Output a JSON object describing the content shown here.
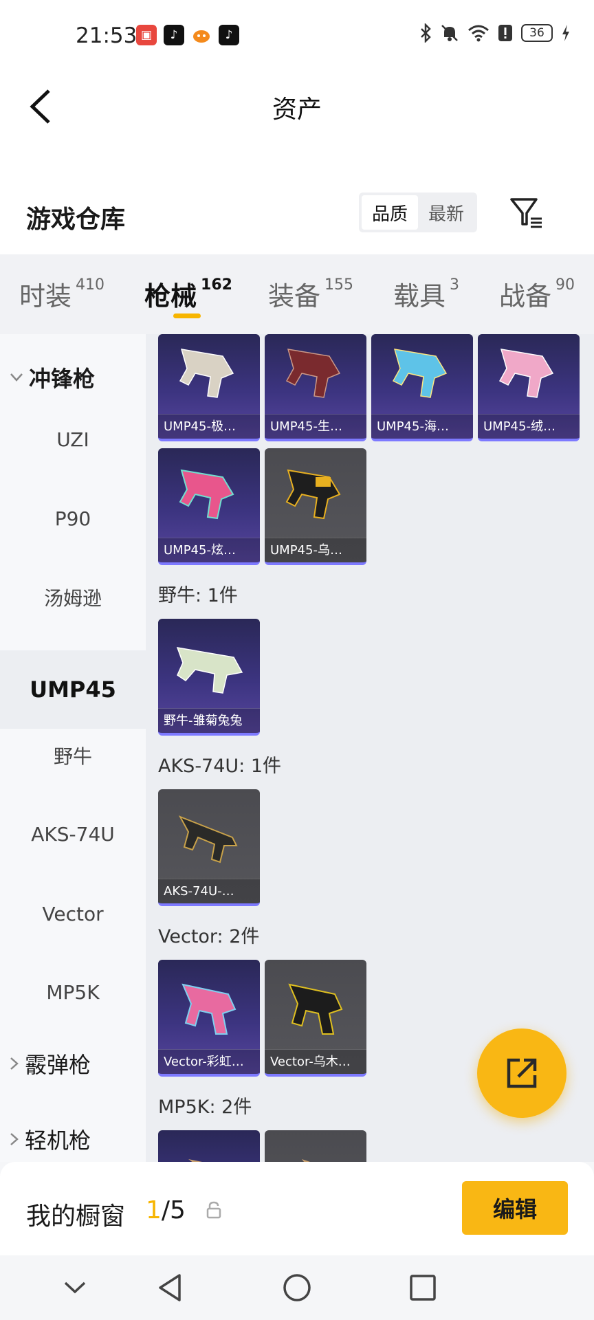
{
  "status_bar": {
    "time": "21:53",
    "apps": [
      "huawei-store",
      "tiktok",
      "taobao",
      "tiktok"
    ],
    "battery": "36"
  },
  "header": {
    "title": "资产"
  },
  "inventory": {
    "title": "游戏仓库",
    "sort_options": [
      "品质",
      "最新"
    ],
    "active_sort": "品质"
  },
  "tabs": [
    {
      "label": "时装",
      "count": "410"
    },
    {
      "label": "枪械",
      "count": "162"
    },
    {
      "label": "装备",
      "count": "155"
    },
    {
      "label": "载具",
      "count": "3"
    },
    {
      "label": "战备",
      "count": "90"
    }
  ],
  "active_tab": "枪械",
  "sidebar": {
    "groups": [
      {
        "label": "冲锋枪",
        "expanded": true
      },
      {
        "label": "霰弹枪",
        "expanded": false
      },
      {
        "label": "轻机枪",
        "expanded": false
      }
    ],
    "items": [
      "UZI",
      "P90",
      "汤姆逊",
      "UMP45",
      "野牛",
      "AKS-74U",
      "Vector",
      "MP5K"
    ],
    "active_item": "UMP45"
  },
  "content": {
    "ump_cards": [
      {
        "label": "UMP45-极…",
        "style": "purple",
        "color": "#d9d2c4"
      },
      {
        "label": "UMP45-生…",
        "style": "purple",
        "color": "#7a2a2e"
      },
      {
        "label": "UMP45-海…",
        "style": "purple",
        "color": "#5ec3e8"
      },
      {
        "label": "UMP45-绒…",
        "style": "purple",
        "color": "#f0a8c8"
      },
      {
        "label": "UMP45-炫…",
        "style": "purple",
        "color": "#e8568c"
      },
      {
        "label": "UMP45-乌…",
        "style": "gray",
        "color": "#e8b020"
      }
    ],
    "groups": [
      {
        "heading": "野牛: 1件",
        "cards": [
          {
            "label": "野牛-雏菊兔兔",
            "style": "purple",
            "color": "#d8e4c8"
          }
        ]
      },
      {
        "heading": "AKS-74U: 1件",
        "cards": [
          {
            "label": "AKS-74U-…",
            "style": "gray",
            "color": "#c9a24a"
          }
        ]
      },
      {
        "heading": "Vector: 2件",
        "cards": [
          {
            "label": "Vector-彩虹…",
            "style": "purple",
            "color": "#e86aa0"
          },
          {
            "label": "Vector-乌木…",
            "style": "gray",
            "color": "#e0c020"
          }
        ]
      },
      {
        "heading": "MP5K: 2件",
        "cards": [
          {
            "label": "",
            "style": "purple",
            "color": "#c8a070"
          },
          {
            "label": "",
            "style": "gray",
            "color": "#c8a070"
          }
        ]
      }
    ]
  },
  "showcase": {
    "title": "我的橱窗",
    "current": "1",
    "total": "/5",
    "edit_label": "编辑"
  },
  "colors": {
    "accent": "#f9b714",
    "card_purple": "#3c3480",
    "card_gray": "#56565b",
    "card_border": "#7d79ff"
  }
}
